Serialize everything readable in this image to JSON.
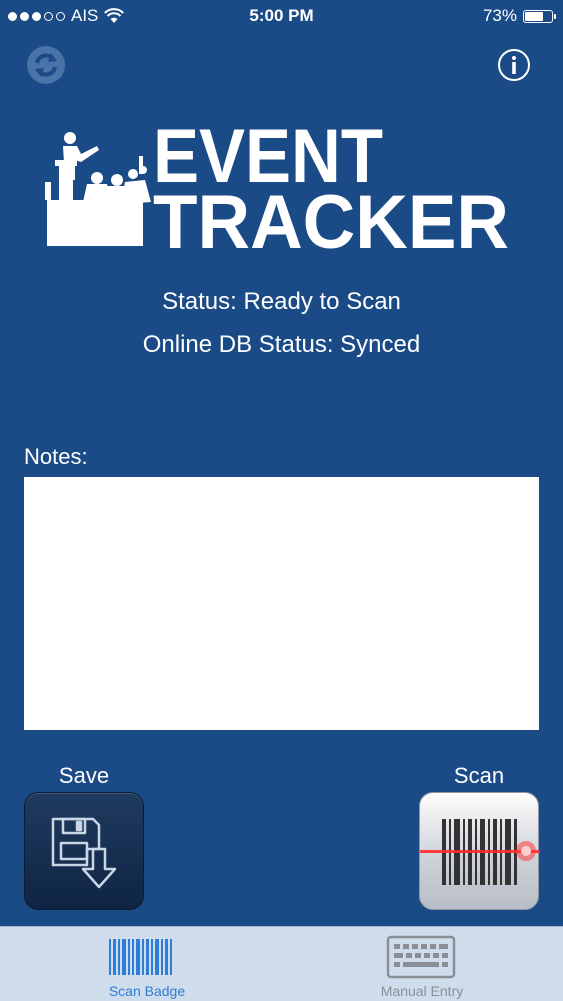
{
  "status_bar": {
    "carrier": "AIS",
    "time": "5:00 PM",
    "battery_text": "73%",
    "battery_level": 0.73
  },
  "header": {
    "refresh_icon": "refresh-icon",
    "info_icon": "info-icon"
  },
  "logo": {
    "line1": "EVENT",
    "line2": "TRACKER"
  },
  "status": {
    "line1": "Status: Ready to Scan",
    "line2": "Online DB Status: Synced"
  },
  "notes": {
    "label": "Notes:",
    "value": ""
  },
  "actions": {
    "save_label": "Save",
    "save_icon": "save-disk-icon",
    "scan_label": "Scan",
    "scan_icon": "barcode-laser-icon"
  },
  "tabs": [
    {
      "label": "Scan Badge",
      "icon": "barcode-icon",
      "active": true
    },
    {
      "label": "Manual Entry",
      "icon": "keyboard-icon",
      "active": false
    }
  ],
  "colors": {
    "background": "#1b4b87",
    "tabbar": "#cfdcec",
    "active_tab": "#2f7dd6",
    "inactive_tab": "#8a8f96"
  }
}
